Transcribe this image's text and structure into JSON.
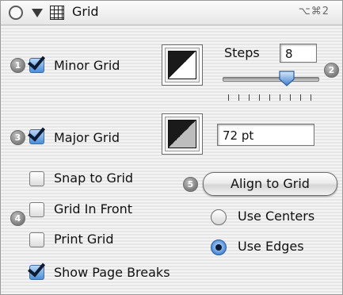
{
  "window": {
    "title": "Grid",
    "shortcut": "⌥⌘2",
    "icons": [
      "close-circle-icon",
      "collapse-triangle-icon",
      "grid-icon"
    ]
  },
  "badges": [
    "1",
    "2",
    "3",
    "4",
    "5"
  ],
  "minor_grid": {
    "label": "Minor Grid",
    "checked": true
  },
  "steps": {
    "label": "Steps",
    "value": "8",
    "slider_value": 8
  },
  "major_grid": {
    "label": "Major Grid",
    "checked": true,
    "spacing": "72 pt"
  },
  "options": {
    "snap_to_grid": {
      "label": "Snap to Grid",
      "checked": false
    },
    "grid_in_front": {
      "label": "Grid In Front",
      "checked": false
    },
    "print_grid": {
      "label": "Print Grid",
      "checked": false
    },
    "show_page_breaks": {
      "label": "Show Page Breaks",
      "checked": true
    }
  },
  "align_button": {
    "label": "Align to Grid"
  },
  "align_mode": {
    "use_centers": {
      "label": "Use Centers",
      "selected": false
    },
    "use_edges": {
      "label": "Use Edges",
      "selected": true
    }
  },
  "colors": {
    "accent": "#4b8fd8",
    "swatch_dark": "#1a1a1a",
    "swatch_light": "#ffffff"
  }
}
